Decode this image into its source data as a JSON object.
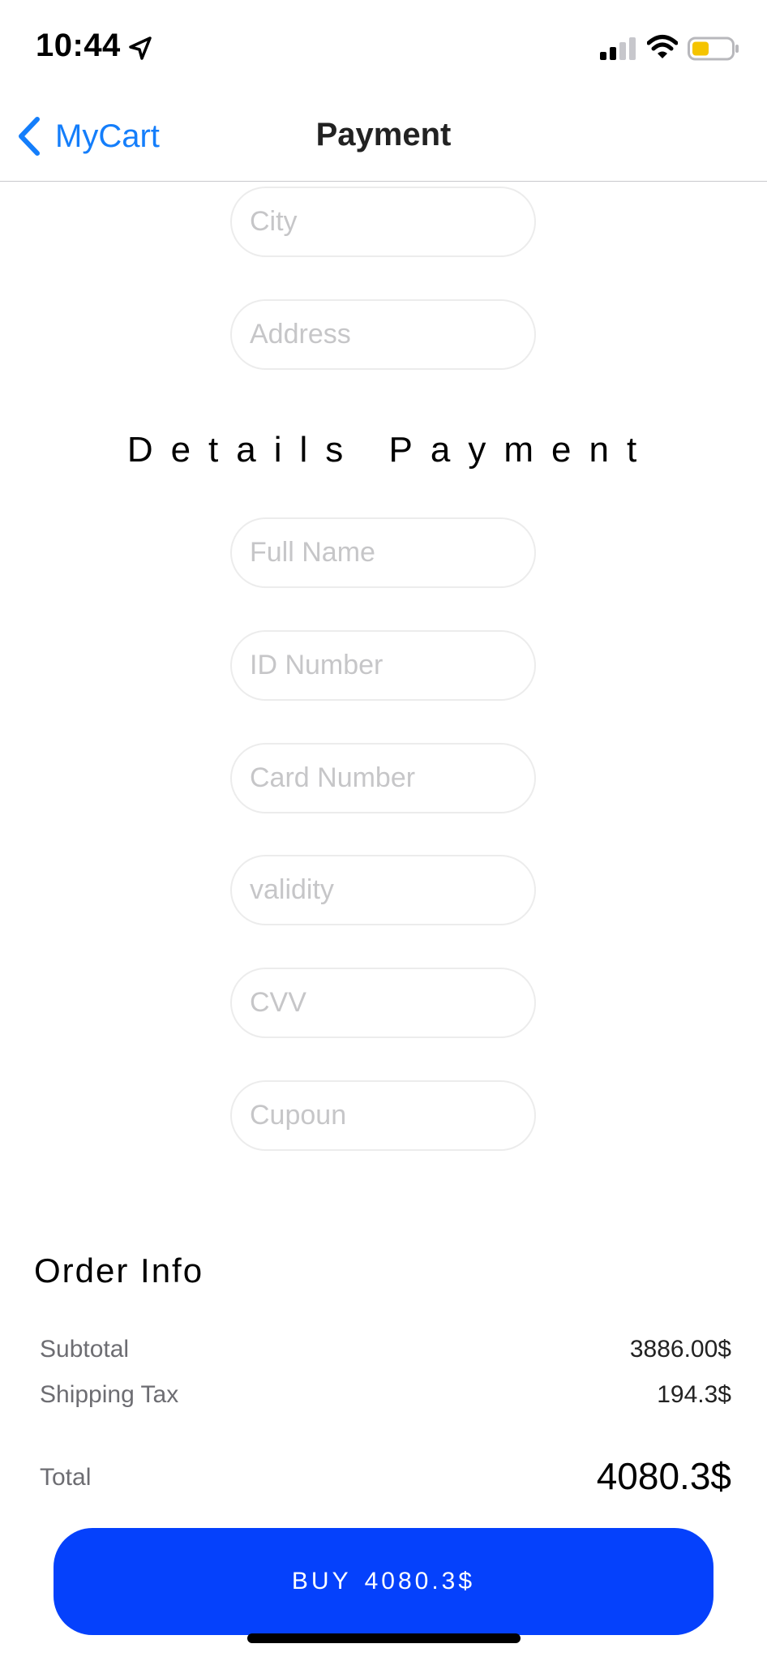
{
  "status_bar": {
    "time": "10:44",
    "icons": [
      "location-arrow-icon",
      "cellular-signal-icon",
      "wifi-icon",
      "battery-icon"
    ],
    "battery_color": "#f5c400"
  },
  "nav": {
    "back_label": "MyCart",
    "title": "Payment",
    "accent_color": "#147efb"
  },
  "address_fields": {
    "city_placeholder": "City",
    "address_placeholder": "Address"
  },
  "payment": {
    "section_title": "Details Payment",
    "full_name_placeholder": "Full Name",
    "id_number_placeholder": "ID Number",
    "card_number_placeholder": "Card Number",
    "validity_placeholder": "validity",
    "cvv_placeholder": "CVV",
    "coupon_placeholder": "Cupoun"
  },
  "order_info": {
    "title": "Order Info",
    "subtotal_label": "Subtotal",
    "subtotal_value": "3886.00$",
    "shipping_label": "Shipping Tax",
    "shipping_value": "194.3$",
    "total_label": "Total",
    "total_value": "4080.3$"
  },
  "buy_button": {
    "label": "BUY",
    "amount": "4080.3$",
    "color": "#0541fc"
  }
}
